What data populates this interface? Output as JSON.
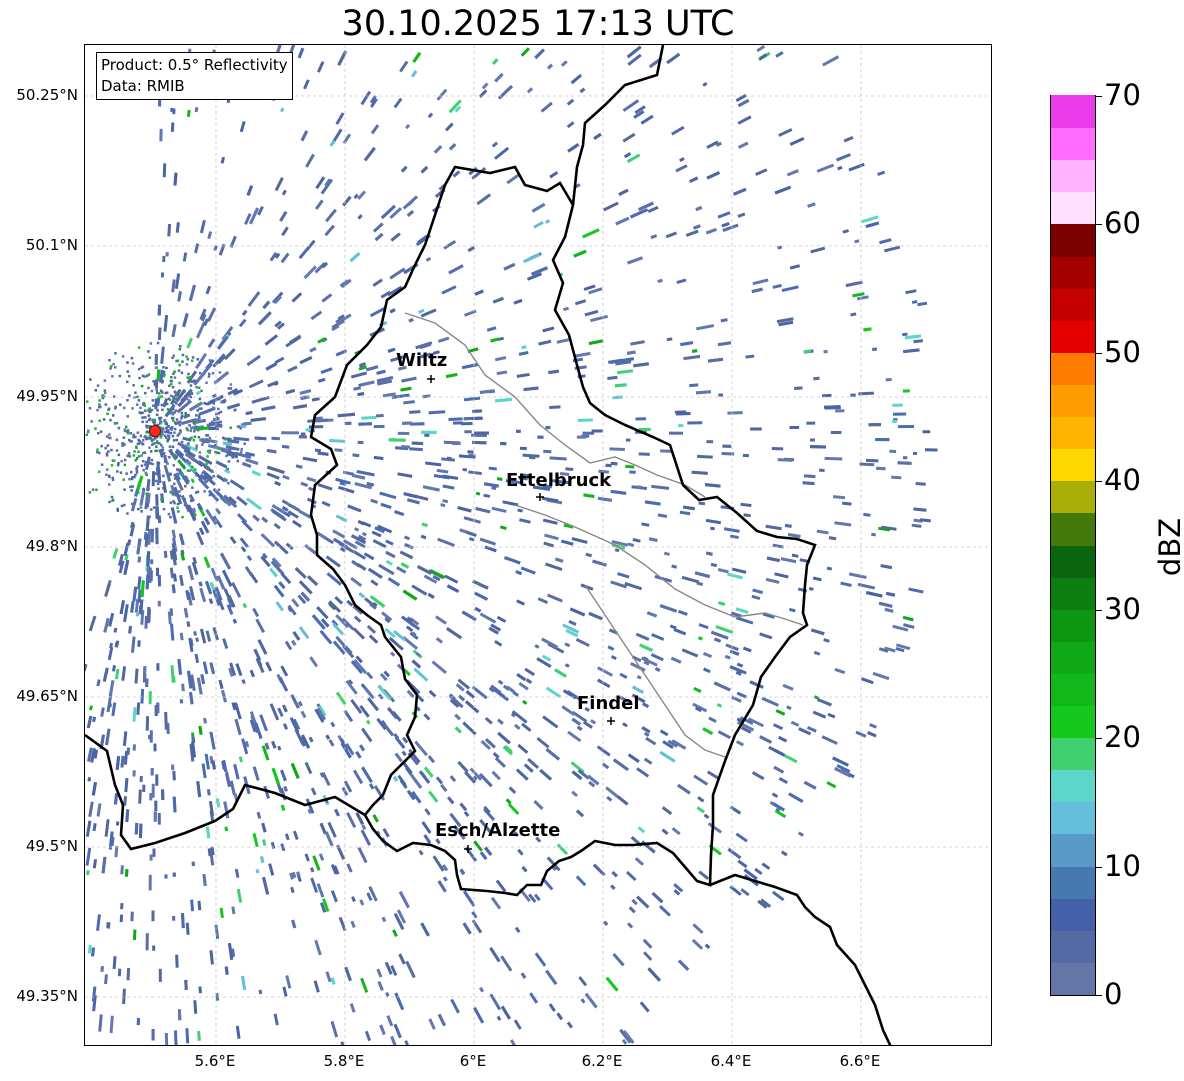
{
  "title": "30.10.2025 17:13 UTC",
  "info": {
    "product": "Product: 0.5° Reflectivity",
    "source": "Data: RMIB"
  },
  "axes": {
    "lat_labels": [
      "50.25°N",
      "50.1°N",
      "49.95°N",
      "49.8°N",
      "49.65°N",
      "49.5°N",
      "49.35°N"
    ],
    "lon_labels": [
      "5.6°E",
      "5.8°E",
      "6°E",
      "6.2°E",
      "6.4°E",
      "6.6°E"
    ]
  },
  "cities": [
    {
      "name": "Wiltz"
    },
    {
      "name": "Ettelbruck"
    },
    {
      "name": "Findel"
    },
    {
      "name": "Esch/Alzette"
    }
  ],
  "radar_site": {
    "marker_color": "#ff2a1a"
  },
  "colorbar": {
    "label": "dBZ",
    "ticks": [
      "0",
      "10",
      "20",
      "30",
      "40",
      "50",
      "60",
      "70"
    ],
    "colors": [
      "#6476a8",
      "#536aa4",
      "#4460a8",
      "#4878b0",
      "#5a9ac8",
      "#66bfda",
      "#5cd6c8",
      "#40d070",
      "#14c81e",
      "#12b81a",
      "#10a816",
      "#0e9612",
      "#0c7e10",
      "#0a6410",
      "#447a0c",
      "#aaae08",
      "#ffd800",
      "#ffb400",
      "#ff9c00",
      "#ff7a00",
      "#e40000",
      "#c40000",
      "#a40000",
      "#7a0000",
      "#ffe0ff",
      "#ffb4ff",
      "#ff6cff",
      "#ea3cea"
    ]
  },
  "colors": {
    "border": "#000000",
    "river": "#888888",
    "grid": "#c8c8c8"
  }
}
